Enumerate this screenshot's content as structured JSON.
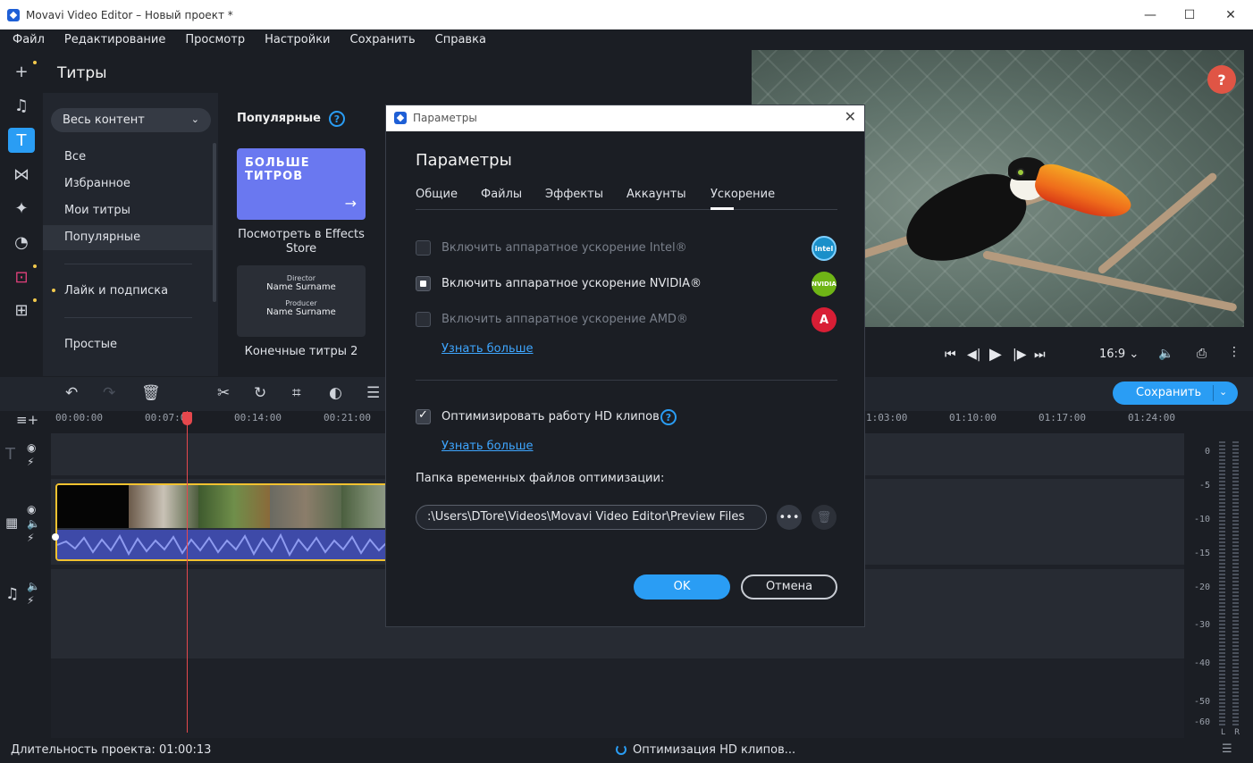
{
  "window": {
    "title": "Movavi Video Editor – Новый проект *",
    "minimize": "—",
    "maximize": "☐",
    "close": "✕"
  },
  "menu": [
    "Файл",
    "Редактирование",
    "Просмотр",
    "Настройки",
    "Сохранить",
    "Справка"
  ],
  "rail": {
    "icons": [
      "plus-icon",
      "music-icon",
      "titles-icon",
      "transitions-icon",
      "filters-icon",
      "stickers-icon",
      "store-icon",
      "more-tools-icon"
    ],
    "active": "titles-icon"
  },
  "titles_panel": {
    "title": "Титры",
    "dropdown_value": "Весь контент",
    "categories": [
      "Все",
      "Избранное",
      "Мои титры",
      "Популярные",
      "Лайк и подписка",
      "Простые"
    ],
    "selected_category": "Популярные",
    "section_title": "Популярные",
    "help": "?",
    "card_more": {
      "big_text": "БОЛЬШЕ ТИТРОВ",
      "arrow": "→",
      "caption": "Посмотреть в Effects Store"
    },
    "card_end": {
      "role1": "Director",
      "name1": "Name Surname",
      "role2": "Producer",
      "name2": "Name Surname",
      "caption": "Конечные титры 2"
    }
  },
  "preview": {
    "help": "?"
  },
  "player": {
    "aspect": "16:9"
  },
  "timeline": {
    "save_label": "Сохранить",
    "ticks": [
      "00:00:00",
      "00:07:0",
      "00:14:00",
      "00:21:00",
      "1:03:00",
      "01:10:00",
      "01:17:00",
      "01:24:00"
    ],
    "meter_labels": [
      "0",
      "-5",
      "-10",
      "-15",
      "-20",
      "-30",
      "-40",
      "-50",
      "-60"
    ],
    "meter_l": "L",
    "meter_r": "R"
  },
  "status": {
    "duration": "Длительность проекта: 01:00:13",
    "task": "Оптимизация HD клипов..."
  },
  "dialog": {
    "window_title": "Параметры",
    "close": "✕",
    "heading": "Параметры",
    "tabs": [
      "Общие",
      "Файлы",
      "Эффекты",
      "Аккаунты",
      "Ускорение"
    ],
    "active_tab": "Ускорение",
    "options": {
      "intel": "Включить аппаратное ускорение Intel®",
      "nvidia": "Включить аппаратное ускорение NVIDIA®",
      "amd": "Включить аппаратное ускорение AMD®",
      "learn_more_1": "Узнать больше",
      "optimize_hd": "Оптимизировать работу HD клипов",
      "learn_more_2": "Узнать больше",
      "folder_label": "Папка временных файлов оптимизации:",
      "folder_path": ":\\Users\\DTore\\Videos\\Movavi Video Editor\\Preview Files"
    },
    "vendor_labels": {
      "intel": "intel",
      "nvidia": "NVIDIA",
      "amd": "A"
    },
    "browse": "•••",
    "ok": "OK",
    "cancel": "Отмена",
    "help": "?"
  }
}
